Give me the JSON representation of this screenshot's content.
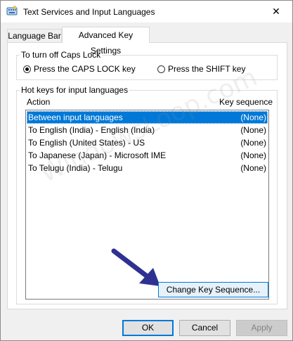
{
  "window": {
    "title": "Text Services and Input Languages",
    "title_icon": "keyboard-icon",
    "close_glyph": "✕"
  },
  "tabs": [
    {
      "label": "Language Bar",
      "active": false
    },
    {
      "label": "Advanced Key Settings",
      "active": true
    }
  ],
  "caps_lock": {
    "group_label": "To turn off Caps Lock",
    "options": [
      {
        "label": "Press the CAPS LOCK key",
        "selected": true
      },
      {
        "label": "Press the SHIFT key",
        "selected": false
      }
    ]
  },
  "hotkeys": {
    "group_label": "Hot keys for input languages",
    "columns": {
      "action": "Action",
      "key_sequence": "Key sequence"
    },
    "rows": [
      {
        "action": "Between input languages",
        "sequence": "(None)",
        "selected": true
      },
      {
        "action": "To English (India) - English (India)",
        "sequence": "(None)",
        "selected": false
      },
      {
        "action": "To English (United States) - US",
        "sequence": "(None)",
        "selected": false
      },
      {
        "action": "To Japanese (Japan) - Microsoft IME",
        "sequence": "(None)",
        "selected": false
      },
      {
        "action": "To Telugu (India) - Telugu",
        "sequence": "(None)",
        "selected": false
      }
    ],
    "change_button": "Change Key Sequence..."
  },
  "footer": {
    "ok": "OK",
    "cancel": "Cancel",
    "apply": "Apply"
  },
  "watermark": "WindowsLoop.com",
  "colors": {
    "accent": "#0078d7",
    "arrow": "#2e3192"
  }
}
